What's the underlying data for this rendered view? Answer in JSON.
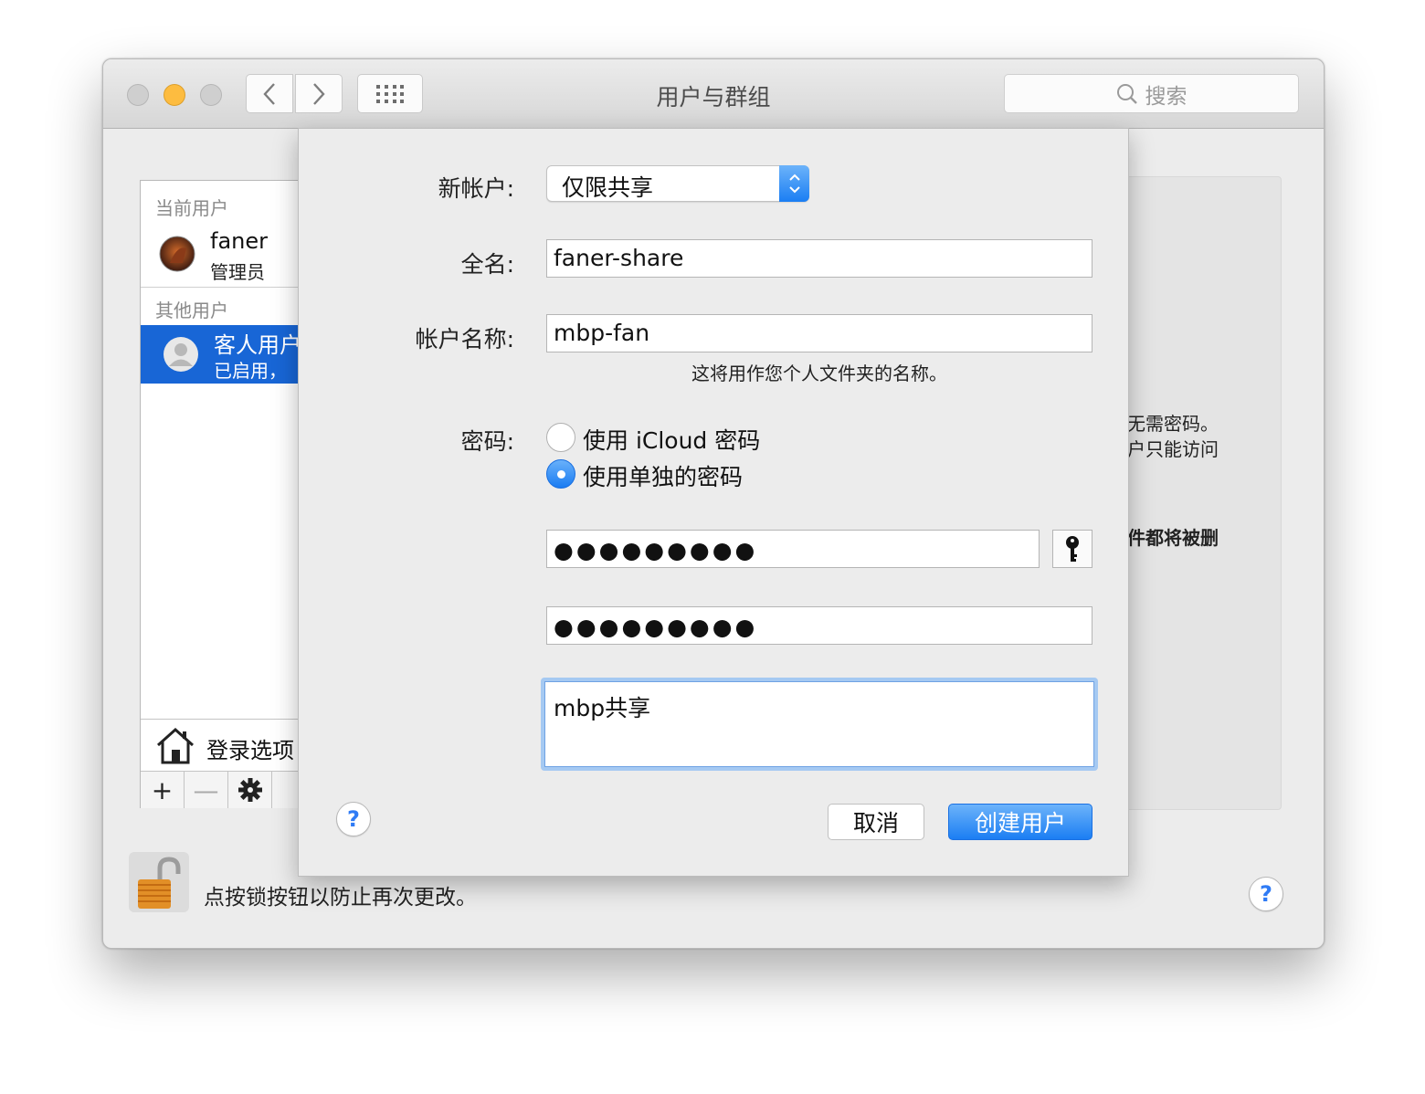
{
  "window": {
    "title": "用户与群组",
    "search_placeholder": "搜索"
  },
  "userlist": {
    "current_header": "当前用户",
    "current_user": {
      "name": "faner",
      "role": "管理员"
    },
    "other_header": "其他用户",
    "guest_user": {
      "name": "客人用户",
      "status": "已启用，"
    },
    "login_options": "登录选项",
    "add": "+",
    "remove": "—"
  },
  "right_panel": {
    "line1": "无需密码。",
    "line2": "户只能访问",
    "line3": "件都将被删"
  },
  "lock": {
    "text": "点按锁按钮以防止再次更改。"
  },
  "sheet": {
    "new_account_label": "新帐户:",
    "new_account_value": "仅限共享",
    "full_name_label": "全名:",
    "full_name_value": "faner-share",
    "account_name_label": "帐户名称:",
    "account_name_value": "mbp-fan",
    "account_name_hint": "这将用作您个人文件夹的名称。",
    "password_label": "密码:",
    "radio_icloud": "使用 iCloud 密码",
    "radio_separate": "使用单独的密码",
    "password_value": "●●●●●●●●●",
    "verify_value": "●●●●●●●●●",
    "password_hint_value": "mbp共享",
    "help": "?",
    "cancel": "取消",
    "create": "创建用户"
  },
  "colors": {
    "accent": "#1b7ef3",
    "selection": "#1866d6"
  }
}
